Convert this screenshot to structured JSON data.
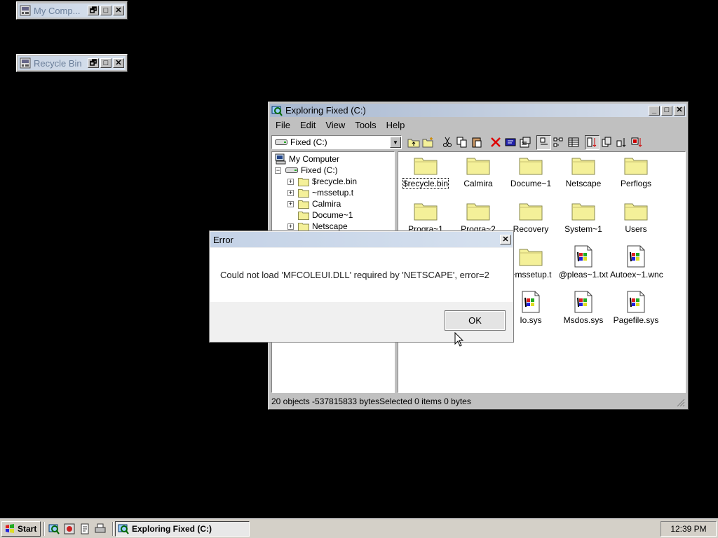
{
  "desktop": {
    "minimized": [
      {
        "title": "My Comp..."
      },
      {
        "title": "Recycle Bin"
      }
    ]
  },
  "window_controls": {
    "restore": "🗗",
    "maximize": "□",
    "minimize": "_",
    "close": "✕"
  },
  "explorer": {
    "title": "Exploring Fixed (C:)",
    "menu": [
      "File",
      "Edit",
      "View",
      "Tools",
      "Help"
    ],
    "drive_combo": "Fixed (C:)",
    "tree": [
      {
        "label": "My Computer",
        "icon": "computer-icon",
        "expander": ""
      },
      {
        "label": "Fixed (C:)",
        "icon": "drive-icon",
        "expander": "−"
      },
      {
        "label": "$recycle.bin",
        "icon": "folder-icon",
        "expander": "+"
      },
      {
        "label": "~mssetup.t",
        "icon": "folder-icon",
        "expander": "+"
      },
      {
        "label": "Calmira",
        "icon": "folder-icon",
        "expander": "+"
      },
      {
        "label": "Docume~1",
        "icon": "folder-icon",
        "expander": ""
      },
      {
        "label": "Netscape",
        "icon": "folder-icon",
        "expander": "+"
      }
    ],
    "files": [
      {
        "label": "$recycle.bin",
        "icon": "folder-icon"
      },
      {
        "label": "Calmira",
        "icon": "folder-icon"
      },
      {
        "label": "Docume~1",
        "icon": "folder-icon"
      },
      {
        "label": "Netscape",
        "icon": "folder-icon"
      },
      {
        "label": "Perflogs",
        "icon": "folder-icon"
      },
      {
        "label": "Progra~1",
        "icon": "folder-icon"
      },
      {
        "label": "Progra~2",
        "icon": "folder-icon"
      },
      {
        "label": "Recovery",
        "icon": "folder-icon"
      },
      {
        "label": "System~1",
        "icon": "folder-icon"
      },
      {
        "label": "Users",
        "icon": "folder-icon"
      },
      {
        "label": "~mssetup.t",
        "icon": "folder-icon"
      },
      {
        "label": "@pleas~1.txt",
        "icon": "system-file-icon"
      },
      {
        "label": "Autoex~1.wnc",
        "icon": "system-file-icon"
      },
      {
        "label": "Io.sys",
        "icon": "system-file-icon"
      },
      {
        "label": "Msdos.sys",
        "icon": "system-file-icon"
      },
      {
        "label": "Pagefile.sys",
        "icon": "system-file-icon"
      }
    ],
    "status": "20 objects  -537815833 bytesSelected 0 items  0 bytes"
  },
  "dialog": {
    "title": "Error",
    "message": "Could not load 'MFCOLEUI.DLL' required by 'NETSCAPE', error=2",
    "ok_label": "OK"
  },
  "taskbar": {
    "start_label": "Start",
    "task_label": "Exploring Fixed (C:)",
    "clock": "12:39 PM"
  },
  "colors": {
    "folder": "#f4f099",
    "titlebar_active": "#a8b8d0",
    "desktop": "#000000"
  }
}
